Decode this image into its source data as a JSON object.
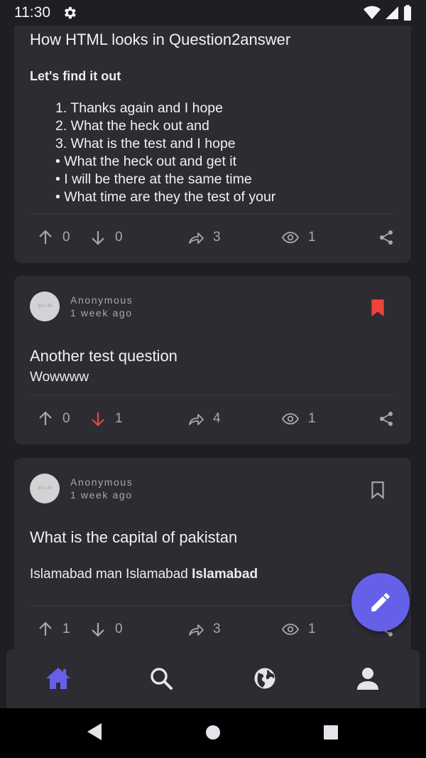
{
  "status": {
    "time": "11:30"
  },
  "cards": [
    {
      "title": "How HTML looks in Question2answer",
      "heading": "Let's find it out",
      "ordered": [
        "1. Thanks again and I hope",
        "2. What the heck out and",
        "3. What is the test and I hope"
      ],
      "bullets": [
        "• What the heck out and get it",
        "• I will be there at the same time",
        "• What time are they the test of your"
      ],
      "upvotes": "0",
      "downvotes": "0",
      "answers": "3",
      "views": "1"
    },
    {
      "author": "Anonymous",
      "time": "1 week ago",
      "avatar_text": "30 x 30",
      "bookmarked": true,
      "title": "Another test question",
      "body": "Wowwww",
      "upvotes": "0",
      "downvotes": "1",
      "answers": "4",
      "views": "1"
    },
    {
      "author": "Anonymous",
      "time": "1 week ago",
      "avatar_text": "30 x 30",
      "bookmarked": false,
      "title": "What is the capital of pakistan",
      "body_plain": "Islamabad man Islamabad ",
      "body_bold": "Islamabad",
      "upvotes": "1",
      "downvotes": "0",
      "answers": "3",
      "views": "1"
    }
  ],
  "colors": {
    "accent": "#6461e8",
    "downvote_active": "#e9473f",
    "bookmark_active": "#f0413a",
    "card": "#2d2c33",
    "background": "#1f1e24"
  },
  "nav": [
    "home-icon",
    "search-icon",
    "globe-icon",
    "user-icon"
  ]
}
